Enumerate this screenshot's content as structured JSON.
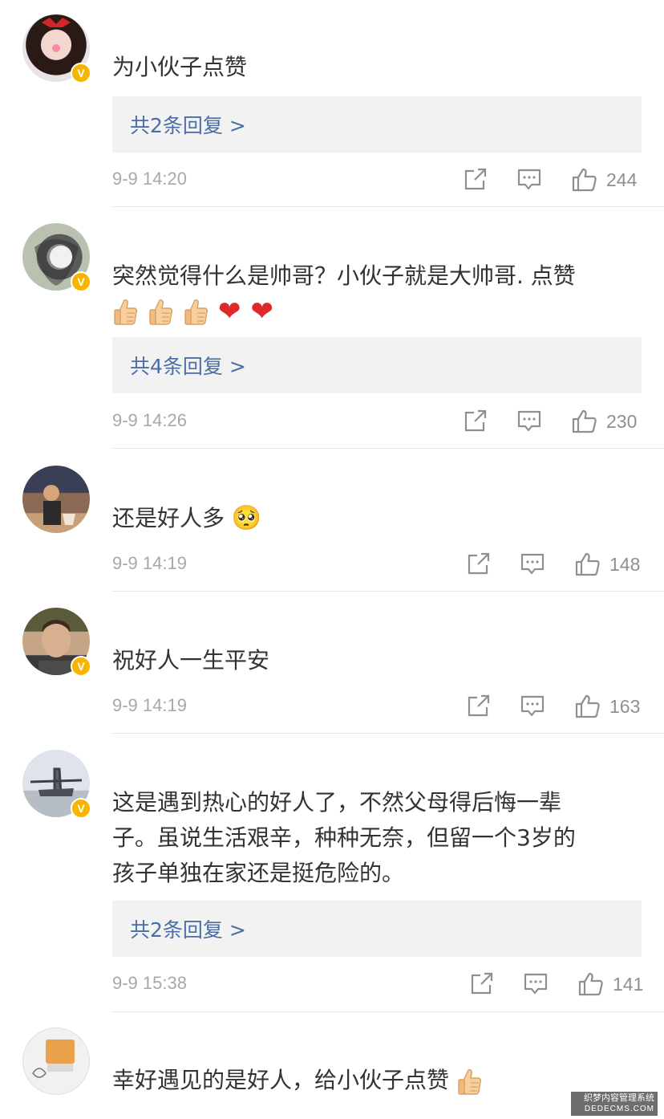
{
  "comments": [
    {
      "text": "为小伙子点赞",
      "reply": "共2条回复 >",
      "time": "9-9 14:20",
      "likes": "244",
      "verified": true
    },
    {
      "text": "突然觉得什么是帅哥？小伙子就是大帅哥. 点赞",
      "emojis": [
        "thumbs-up",
        "thumbs-up",
        "thumbs-up",
        "heart",
        "heart"
      ],
      "reply": "共4条回复 >",
      "time": "9-9 14:26",
      "likes": "230",
      "verified": true
    },
    {
      "text": "还是好人多",
      "emoji": "🥺",
      "time": "9-9 14:19",
      "likes": "148",
      "verified": false
    },
    {
      "text": "祝好人一生平安",
      "time": "9-9 14:19",
      "likes": "163",
      "verified": true
    },
    {
      "text_lines": [
        "这是遇到热心的好人了，不然父母得后悔一辈",
        "子。虽说生活艰辛，种种无奈，但留一个3岁的",
        "孩子单独在家还是挺危险的。"
      ],
      "reply": "共2条回复 >",
      "time": "9-9 15:38",
      "likes": "141",
      "verified": true
    },
    {
      "text": "幸好遇见的是好人，给小伙子点赞",
      "emojis": [
        "thumbs-up"
      ],
      "verified": false
    }
  ],
  "icons": {
    "share": "share-icon",
    "comment": "comment-icon",
    "like": "thumb-up-icon",
    "verified": "verified-v-icon"
  },
  "colors": {
    "reply_link": "#4a6ea5",
    "verified_badge": "#f7b500",
    "reply_bg": "#f2f2f2",
    "meta_text": "#a8a8a8"
  },
  "watermark": {
    "line1": "织梦内容管理系统",
    "line2": "DEDECMS.COM"
  },
  "badge_letter": "V"
}
